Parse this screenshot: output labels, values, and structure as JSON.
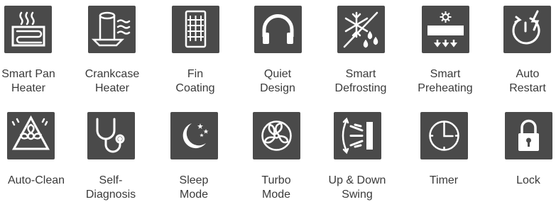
{
  "features": [
    {
      "icon": "pan-heater-icon",
      "label": "Smart Pan\nHeater"
    },
    {
      "icon": "crankcase-heater-icon",
      "label": "Crankcase\nHeater"
    },
    {
      "icon": "fin-coating-icon",
      "label": "Fin\nCoating"
    },
    {
      "icon": "headphones-icon",
      "label": "Quiet\nDesign"
    },
    {
      "icon": "snowflake-drops-icon",
      "label": "Smart\nDefrosting"
    },
    {
      "icon": "ac-preheat-icon",
      "label": "Smart\nPreheating"
    },
    {
      "icon": "power-restart-icon",
      "label": "Auto\nRestart"
    },
    {
      "icon": "auto-clean-icon",
      "label": "Auto-Clean"
    },
    {
      "icon": "stethoscope-icon",
      "label": "Self-\nDiagnosis"
    },
    {
      "icon": "moon-stars-icon",
      "label": "Sleep\nMode"
    },
    {
      "icon": "fan-icon",
      "label": "Turbo\nMode"
    },
    {
      "icon": "swing-icon",
      "label": "Up & Down\nSwing"
    },
    {
      "icon": "clock-icon",
      "label": "Timer"
    },
    {
      "icon": "padlock-icon",
      "label": "Lock"
    }
  ],
  "colors": {
    "tile": "#4a4a4a",
    "icon": "#ffffff",
    "text": "#3a3a3a"
  }
}
